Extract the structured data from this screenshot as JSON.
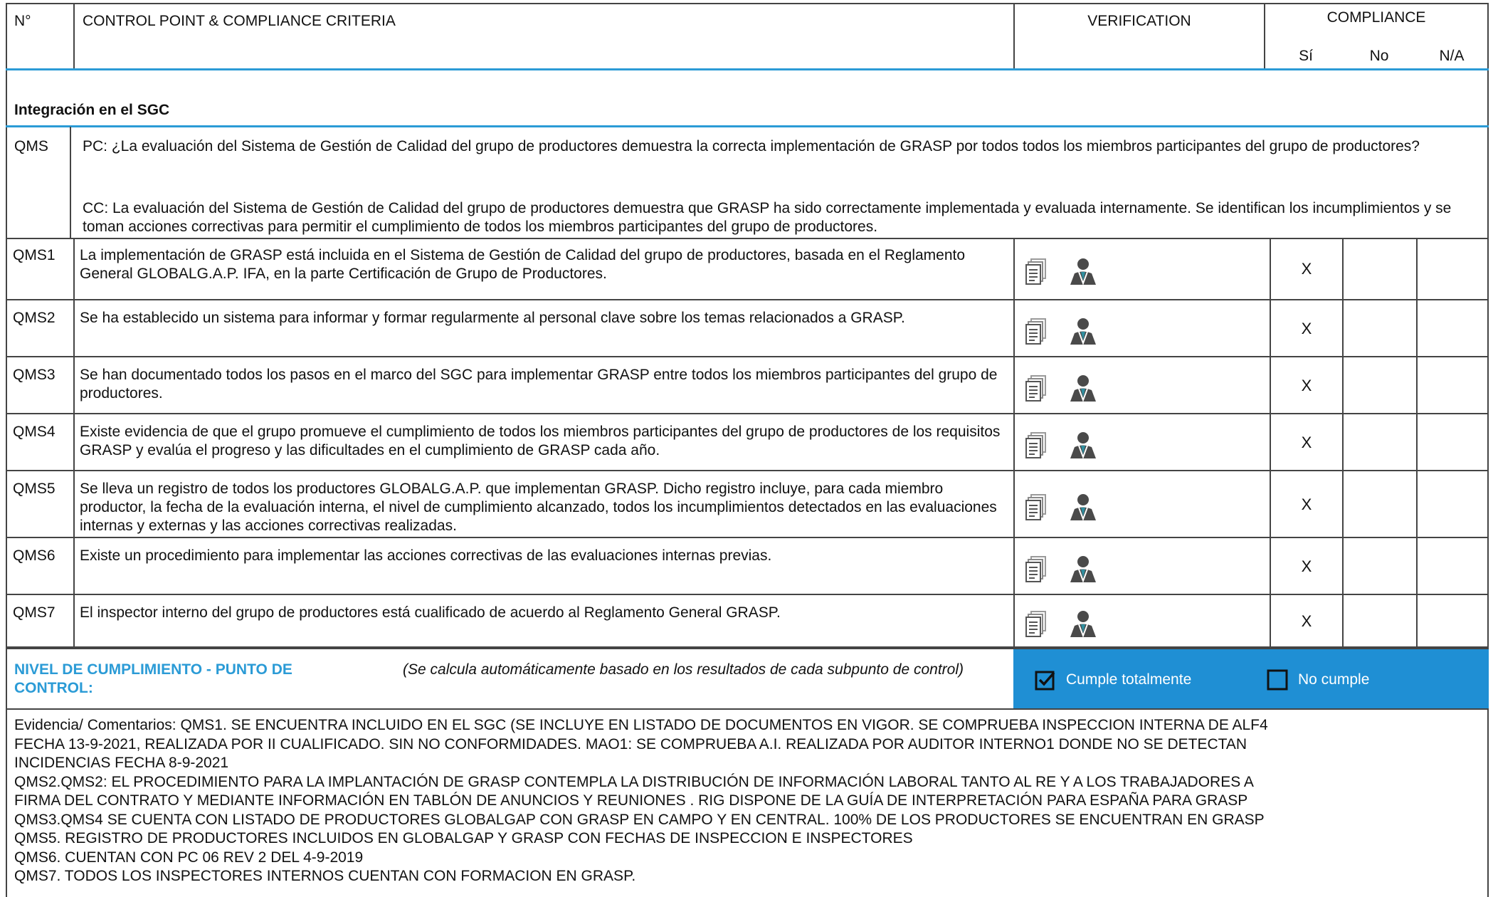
{
  "header": {
    "num": "N°",
    "control": "CONTROL POINT & COMPLIANCE CRITERIA",
    "verification": "VERIFICATION",
    "compliance": "COMPLIANCE",
    "si": "Sí",
    "no": "No",
    "na": "N/A"
  },
  "section": {
    "title": "Integración en el SGC"
  },
  "qms": {
    "code": "QMS",
    "pc": "PC: ¿La evaluación del Sistema de Gestión de Calidad del grupo de productores demuestra la correcta implementación de GRASP por todos todos los miembros participantes del grupo de productores?",
    "cc": "CC: La evaluación del Sistema de Gestión de Calidad del grupo de productores demuestra que GRASP ha sido correctamente implementada y evaluada internamente. Se identifican los incumplimientos y se toman acciones correctivas para permitir el cumplimiento de todos los miembros participantes del grupo de productores."
  },
  "rows": [
    {
      "code": "QMS1",
      "text": "La implementación de GRASP está incluida en el Sistema de Gestión de Calidad del grupo de productores, basada en el Reglamento General GLOBALG.A.P. IFA, en la parte Certificación de Grupo de Productores.",
      "si": "X",
      "no": "",
      "na": ""
    },
    {
      "code": "QMS2",
      "text": "Se ha establecido un sistema para informar  y formar regularmente al personal clave sobre los temas relacionados a GRASP.",
      "si": "X",
      "no": "",
      "na": ""
    },
    {
      "code": "QMS3",
      "text": "Se han documentado todos los pasos en el marco del SGC para implementar GRASP entre todos los miembros participantes del grupo de productores.",
      "si": "X",
      "no": "",
      "na": ""
    },
    {
      "code": "QMS4",
      "text": "Existe evidencia de que el grupo promueve el cumplimiento de todos los miembros participantes del grupo de productores de los requisitos GRASP y evalúa el progreso y las dificultades en el cumplimiento de GRASP cada año.",
      "si": "X",
      "no": "",
      "na": ""
    },
    {
      "code": "QMS5",
      "text": "Se lleva un registro de todos los productores GLOBALG.A.P. que implementan GRASP. Dicho registro incluye, para cada miembro productor, la fecha de la evaluación interna, el nivel de cumplimiento alcanzado, todos los incumplimientos detectados en las evaluaciones internas y externas y las acciones correctivas realizadas.",
      "si": "X",
      "no": "",
      "na": ""
    },
    {
      "code": "QMS6",
      "text": "Existe un procedimiento para implementar las acciones correctivas de las evaluaciones internas previas.",
      "si": "X",
      "no": "",
      "na": ""
    },
    {
      "code": "QMS7",
      "text": "El inspector interno del grupo de productores está cualificado de acuerdo al Reglamento General GRASP.",
      "si": "X",
      "no": "",
      "na": ""
    }
  ],
  "icons": {
    "document": "document-icon",
    "person": "inspector-person-icon"
  },
  "summary": {
    "label": "NIVEL DE CUMPLIMIENTO - PUNTO DE CONTROL:",
    "note": "(Se calcula automáticamente basado en los resultados de cada subpunto de control)",
    "option_full": "Cumple totalmente",
    "option_fail": "No cumple",
    "full_checked": true,
    "fail_checked": false
  },
  "comments": [
    "Evidencia/ Comentarios: QMS1. SE ENCUENTRA INCLUIDO EN EL SGC (SE INCLUYE EN LISTADO DE DOCUMENTOS EN VIGOR. SE COMPRUEBA INSPECCION INTERNA DE ALF4",
    "FECHA 13-9-2021, REALIZADA POR II CUALIFICADO. SIN NO CONFORMIDADES. MAO1: SE COMPRUEBA A.I.  REALIZADA POR AUDITOR INTERNO1  DONDE  NO SE DETECTAN",
    "INCIDENCIAS FECHA 8-9-2021",
    "QMS2.QMS2: EL PROCEDIMIENTO PARA LA IMPLANTACIÓN DE GRASP  CONTEMPLA LA DISTRIBUCIÓN DE INFORMACIÓN LABORAL  TANTO AL RE Y A LOS TRABAJADORES A",
    "FIRMA DEL CONTRATO Y MEDIANTE INFORMACIÓN EN TABLÓN DE ANUNCIOS Y REUNIONES . RIG DISPONE DE LA GUÍA DE INTERPRETACIÓN PARA ESPAÑA PARA GRASP",
    "QMS3.QMS4 SE CUENTA CON LISTADO DE PRODUCTORES GLOBALGAP CON GRASP EN CAMPO Y EN CENTRAL. 100% DE LOS PRODUCTORES SE ENCUENTRAN EN GRASP",
    "QMS5. REGISTRO DE PRODUCTORES INCLUIDOS EN GLOBALGAP Y GRASP CON FECHAS DE INSPECCION E INSPECTORES",
    "QMS6. CUENTAN CON PC 06 REV 2 DEL 4-9-2019",
    "QMS7. TODOS LOS INSPECTORES INTERNOS CUENTAN CON FORMACION EN GRASP."
  ],
  "colors": {
    "accent_blue": "#2b9bd6",
    "summary_fill": "#1f8fd4",
    "summary_text": "#2b9bd6"
  }
}
